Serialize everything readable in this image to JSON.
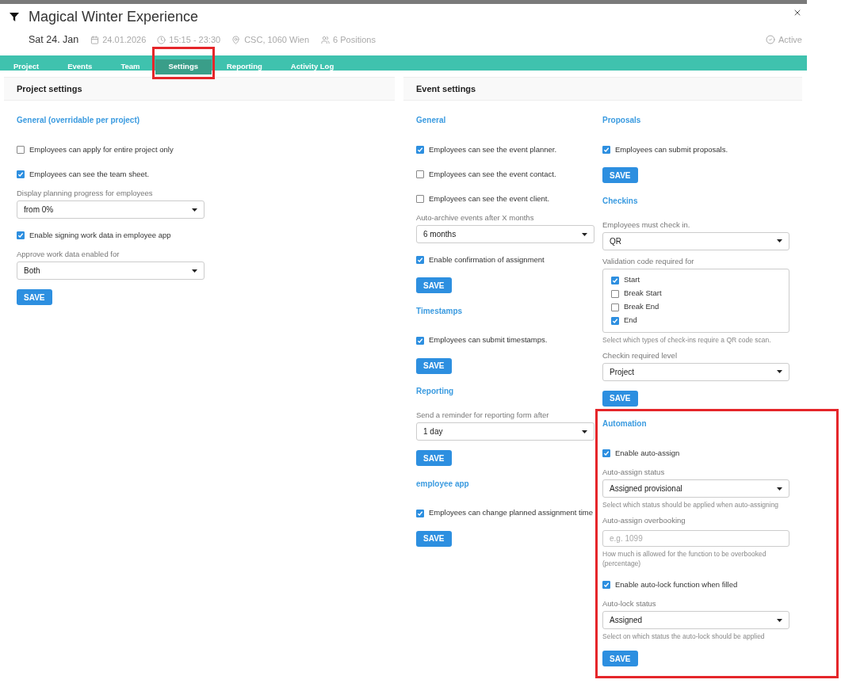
{
  "header": {
    "title": "Magical Winter Experience",
    "day": "Sat 24. Jan",
    "date": "24.01.2026",
    "time": "15:15 - 23:30",
    "location": "CSC, 1060 Wien",
    "positions": "6 Positions",
    "status": "Active"
  },
  "tabs": [
    {
      "label": "Project",
      "selected": false,
      "highlighted": false
    },
    {
      "label": "Events",
      "selected": false,
      "highlighted": false
    },
    {
      "label": "Team",
      "selected": false,
      "highlighted": false
    },
    {
      "label": "Settings",
      "selected": true,
      "highlighted": true
    },
    {
      "label": "Reporting",
      "selected": false,
      "highlighted": false
    },
    {
      "label": "Activity Log",
      "selected": false,
      "highlighted": false
    }
  ],
  "project_settings": {
    "title": "Project settings",
    "sections": [
      {
        "heading": "General (overridable per project)",
        "highlighted": false,
        "button": "SAVE",
        "fields": [
          {
            "kind": "checkbox",
            "label": "Employees can apply for entire project only",
            "checked": false
          },
          {
            "kind": "checkbox",
            "label": "Employees can see the team sheet.",
            "checked": true
          },
          {
            "kind": "select",
            "label": "Display planning progress for employees",
            "value": "from 0%"
          },
          {
            "kind": "checkbox",
            "label": "Enable signing work data in employee app",
            "checked": true
          },
          {
            "kind": "select",
            "label": "Approve work data enabled for",
            "value": "Both"
          }
        ]
      }
    ]
  },
  "event_settings": {
    "title": "Event settings",
    "columns": [
      [
        {
          "heading": "General",
          "highlighted": false,
          "button": "SAVE",
          "fields": [
            {
              "kind": "checkbox",
              "label": "Employees can see the event planner.",
              "checked": true
            },
            {
              "kind": "checkbox",
              "label": "Employees can see the event contact.",
              "checked": false
            },
            {
              "kind": "checkbox",
              "label": "Employees can see the event client.",
              "checked": false
            },
            {
              "kind": "select",
              "label": "Auto-archive events after X months",
              "value": "6 months"
            },
            {
              "kind": "checkbox",
              "label": "Enable confirmation of assignment",
              "checked": true
            }
          ]
        },
        {
          "heading": "Timestamps",
          "highlighted": false,
          "button": "SAVE",
          "fields": [
            {
              "kind": "checkbox",
              "label": "Employees can submit timestamps.",
              "checked": true
            }
          ]
        },
        {
          "heading": "Reporting",
          "highlighted": false,
          "button": "SAVE",
          "fields": [
            {
              "kind": "select",
              "label": "Send a reminder for reporting form after",
              "value": "1 day"
            }
          ]
        },
        {
          "heading": "employee app",
          "highlighted": false,
          "button": "SAVE",
          "fields": [
            {
              "kind": "checkbox",
              "label": "Employees can change planned assignment time",
              "checked": true
            }
          ]
        }
      ],
      [
        {
          "heading": "Proposals",
          "highlighted": false,
          "button": "SAVE",
          "fields": [
            {
              "kind": "checkbox",
              "label": "Employees can submit proposals.",
              "checked": true
            }
          ]
        },
        {
          "heading": "Checkins",
          "highlighted": false,
          "button": "SAVE",
          "fields": [
            {
              "kind": "select",
              "label": "Employees must check in.",
              "value": "QR"
            },
            {
              "kind": "checklist",
              "label": "Validation code required for",
              "hint": "Select which types of check-ins require a QR code scan.",
              "items": [
                {
                  "label": "Start",
                  "checked": true
                },
                {
                  "label": "Break Start",
                  "checked": false
                },
                {
                  "label": "Break End",
                  "checked": false
                },
                {
                  "label": "End",
                  "checked": true
                }
              ]
            },
            {
              "kind": "select",
              "label": "Checkin required level",
              "value": "Project"
            }
          ]
        },
        {
          "heading": "Automation",
          "highlighted": true,
          "button": "SAVE",
          "fields": [
            {
              "kind": "checkbox",
              "label": "Enable auto-assign",
              "checked": true
            },
            {
              "kind": "select",
              "label": "Auto-assign status",
              "value": "Assigned provisional",
              "hint": "Select which status should be applied when auto-assigning"
            },
            {
              "kind": "input",
              "label": "Auto-assign overbooking",
              "placeholder": "e.g. 1099",
              "hint": "How much is allowed for the function to be overbooked (percentage)"
            },
            {
              "kind": "checkbox",
              "label": "Enable auto-lock function when filled",
              "checked": true
            },
            {
              "kind": "select",
              "label": "Auto-lock status",
              "value": "Assigned",
              "hint": "Select on which status the auto-lock should be applied"
            }
          ]
        }
      ]
    ]
  }
}
